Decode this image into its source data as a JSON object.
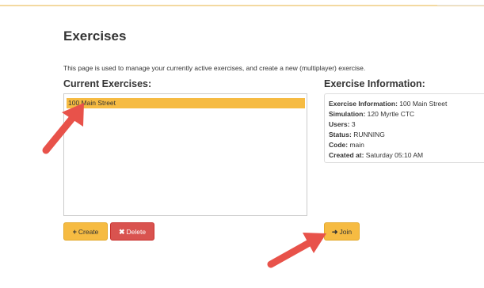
{
  "page": {
    "title": "Exercises",
    "intro": "This page is used to manage your currently active exercises, and create a new (multiplayer) exercise."
  },
  "current_exercises": {
    "heading": "Current Exercises:",
    "items": [
      {
        "label": "100 Main Street",
        "selected": true
      }
    ]
  },
  "exercise_information": {
    "heading": "Exercise Information:",
    "fields": [
      {
        "label": "Exercise Information:",
        "value": "100 Main Street"
      },
      {
        "label": "Simulation:",
        "value": "120 Myrtle CTC"
      },
      {
        "label": "Users:",
        "value": "3"
      },
      {
        "label": "Status:",
        "value": "RUNNING"
      },
      {
        "label": "Code:",
        "value": "main"
      },
      {
        "label": "Created at:",
        "value": "Saturday 05:10 AM"
      }
    ]
  },
  "buttons": {
    "create": {
      "label": "Create",
      "icon": "plus-icon",
      "glyph": "+"
    },
    "delete": {
      "label": "Delete",
      "icon": "x-icon",
      "glyph": "✖"
    },
    "join": {
      "label": "Join",
      "icon": "sign-in-icon",
      "glyph": "➜"
    }
  },
  "colors": {
    "accent": "#f6bb42",
    "danger": "#d9534f",
    "annotation_arrow": "#e8524a"
  }
}
